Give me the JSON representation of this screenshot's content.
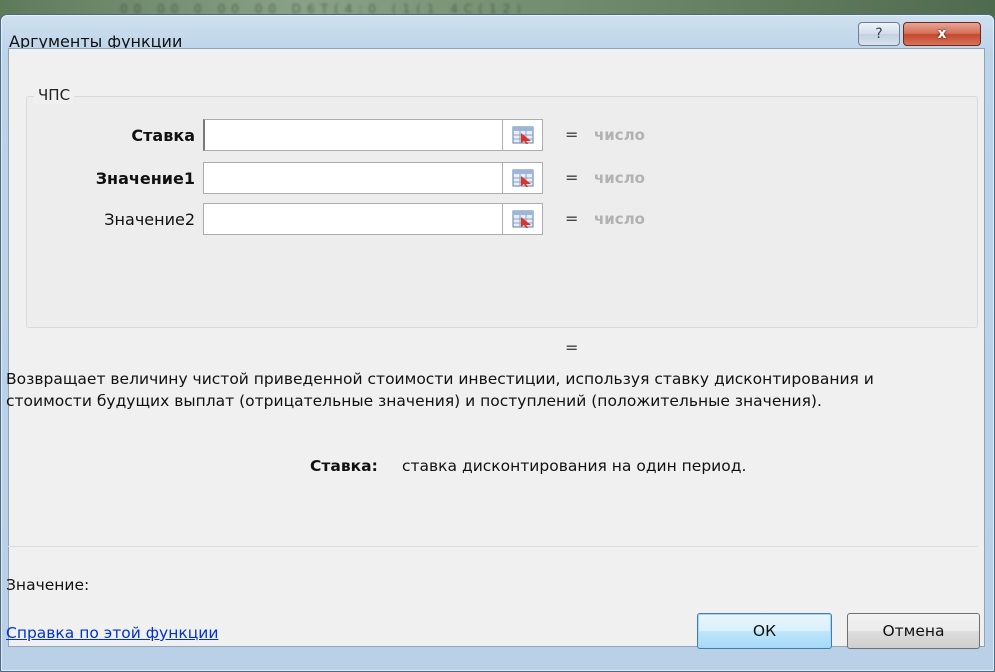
{
  "background": {
    "blur_text": "00 00  0  00 00  D6T(4:0  (1(1 4C(12)"
  },
  "dialog": {
    "title": "Аргументы функции",
    "help_button": "?",
    "close_button": "x"
  },
  "function": {
    "name": "ЧПС",
    "result_equals": "="
  },
  "arguments": [
    {
      "label": "Ставка",
      "bold": true,
      "value": "",
      "equals": "=",
      "result": "число"
    },
    {
      "label": "Значение1",
      "bold": true,
      "value": "",
      "equals": "=",
      "result": "число"
    },
    {
      "label": "Значение2",
      "bold": false,
      "value": "",
      "equals": "=",
      "result": "число"
    }
  ],
  "description": "Возвращает величину чистой приведенной стоимости инвестиции, используя ставку дисконтирования и стоимости будущих выплат (отрицательные значения) и поступлений (положительные значения).",
  "argument_help": {
    "name": "Ставка:",
    "text": "ставка дисконтирования на один период."
  },
  "value_label": "Значение:",
  "help_link": "Справка по этой функции",
  "buttons": {
    "ok": "ОК",
    "cancel": "Отмена"
  },
  "colors": {
    "link": "#0033cc",
    "result_placeholder": "#b2b2b2",
    "close_button": "#c4472d"
  },
  "icons": {
    "ref": "range-select-icon"
  }
}
